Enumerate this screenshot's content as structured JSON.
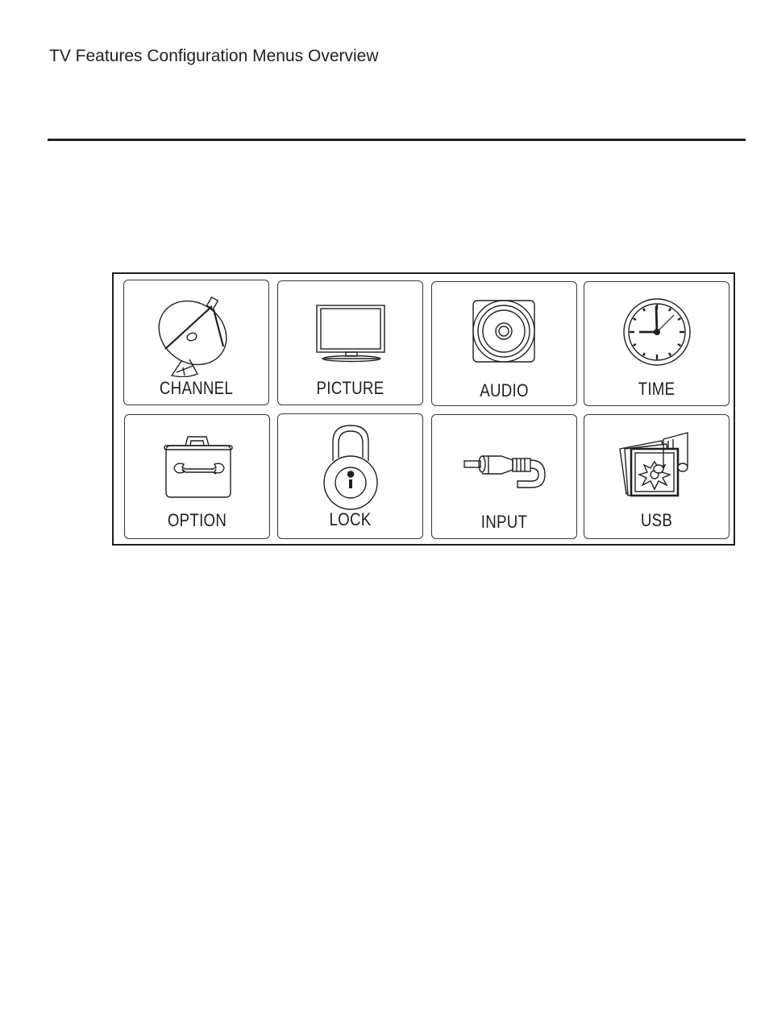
{
  "page": {
    "title": "TV Features Configuration Menus Overview"
  },
  "menu": {
    "items": [
      {
        "label": "CHANNEL",
        "icon": "satellite-dish-icon"
      },
      {
        "label": "PICTURE",
        "icon": "tv-monitor-icon"
      },
      {
        "label": "AUDIO",
        "icon": "speaker-icon"
      },
      {
        "label": "TIME",
        "icon": "clock-icon"
      },
      {
        "label": "OPTION",
        "icon": "toolbox-wrench-icon"
      },
      {
        "label": "LOCK",
        "icon": "padlock-icon"
      },
      {
        "label": "INPUT",
        "icon": "rca-cable-icon"
      },
      {
        "label": "USB",
        "icon": "photo-music-icon"
      }
    ]
  }
}
